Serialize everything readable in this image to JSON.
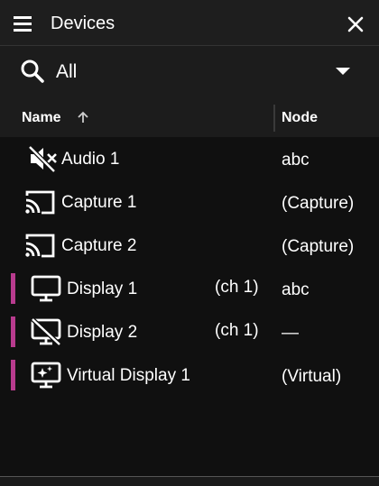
{
  "header": {
    "title": "Devices"
  },
  "filter": {
    "value": "All"
  },
  "table": {
    "columns": {
      "name": "Name",
      "node": "Node"
    },
    "rows": [
      {
        "label": "Audio 1",
        "channel": "",
        "node": "abc",
        "icon": "speaker-muted-icon",
        "marked": false
      },
      {
        "label": "Capture 1",
        "channel": "",
        "node": "(Capture)",
        "icon": "cast-icon",
        "marked": false
      },
      {
        "label": "Capture 2",
        "channel": "",
        "node": "(Capture)",
        "icon": "cast-icon",
        "marked": false
      },
      {
        "label": "Display 1",
        "channel": "(ch 1)",
        "node": "abc",
        "icon": "monitor-icon",
        "marked": true
      },
      {
        "label": "Display 2",
        "channel": "(ch 1)",
        "node": "—",
        "icon": "monitor-off-icon",
        "marked": true
      },
      {
        "label": "Virtual Display 1",
        "channel": "",
        "node": "(Virtual)",
        "icon": "virtual-monitor-icon",
        "marked": true
      }
    ]
  },
  "colors": {
    "marker": "#b83b8e",
    "background": "#101010",
    "header": "#1e1e1e"
  }
}
